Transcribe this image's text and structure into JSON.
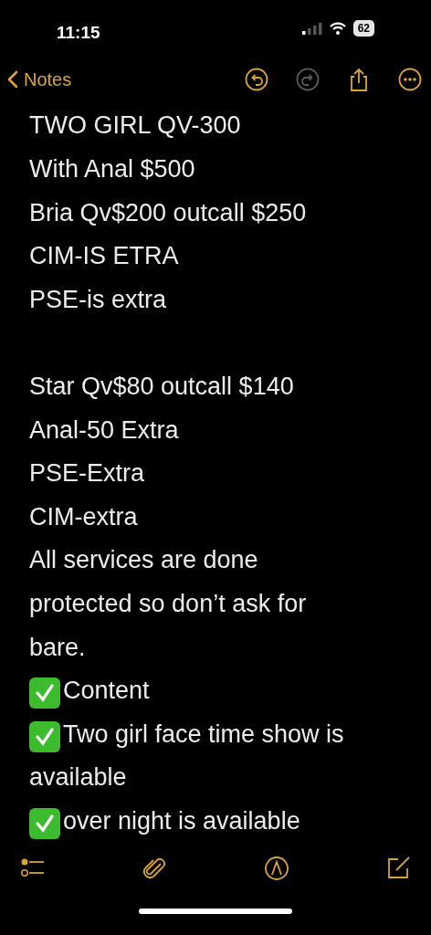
{
  "status_bar": {
    "time": "11:15",
    "battery": "62"
  },
  "nav": {
    "back_label": "Notes",
    "actions": [
      {
        "kind": "undo",
        "disabled": false
      },
      {
        "kind": "redo",
        "disabled": true
      },
      {
        "kind": "share",
        "disabled": false
      },
      {
        "kind": "more",
        "disabled": false
      }
    ]
  },
  "note": {
    "blocks": [
      [
        {
          "text": "TWO GIRL QV-300",
          "checked": false
        },
        {
          "text": "With Anal $500",
          "checked": false
        },
        {
          "text": "Bria Qv$200 outcall $250",
          "checked": false
        },
        {
          "text": "CIM-IS ETRA",
          "checked": false
        },
        {
          "text": "PSE-is extra",
          "checked": false
        }
      ],
      [
        {
          "text": "Star Qv$80 outcall $140",
          "checked": false
        },
        {
          "text": "Anal-50 Extra",
          "checked": false
        },
        {
          "text": "PSE-Extra",
          "checked": false
        },
        {
          "text": "CIM-extra",
          "checked": false
        },
        {
          "text": "All services are done protected so don’t ask for bare.",
          "checked": false
        },
        {
          "text": "Content",
          "checked": true
        },
        {
          "text": "Two girl face time show is available",
          "checked": true
        },
        {
          "text": "over night is available",
          "checked": true
        }
      ]
    ]
  },
  "bottom_toolbar": [
    {
      "kind": "checklist"
    },
    {
      "kind": "attachment"
    },
    {
      "kind": "markup"
    },
    {
      "kind": "compose"
    }
  ]
}
